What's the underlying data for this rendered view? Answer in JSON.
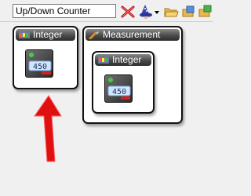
{
  "search": {
    "value": "Up/Down Counter"
  },
  "toolbar": {
    "icons": [
      "clear-x-icon",
      "wizard-icon",
      "dropdown-arrow-icon",
      "folder-open-icon",
      "folder-copy-icon",
      "folder-export-icon"
    ]
  },
  "nodes": {
    "integer_top": {
      "title": "Integer",
      "counter_digits": "450"
    },
    "measurement": {
      "title": "Measurement",
      "child": {
        "title": "Integer",
        "counter_digits": "450"
      }
    }
  },
  "colors": {
    "arrow": "#e01010",
    "header_dark": "#3a3a3a",
    "border": "#111111"
  }
}
